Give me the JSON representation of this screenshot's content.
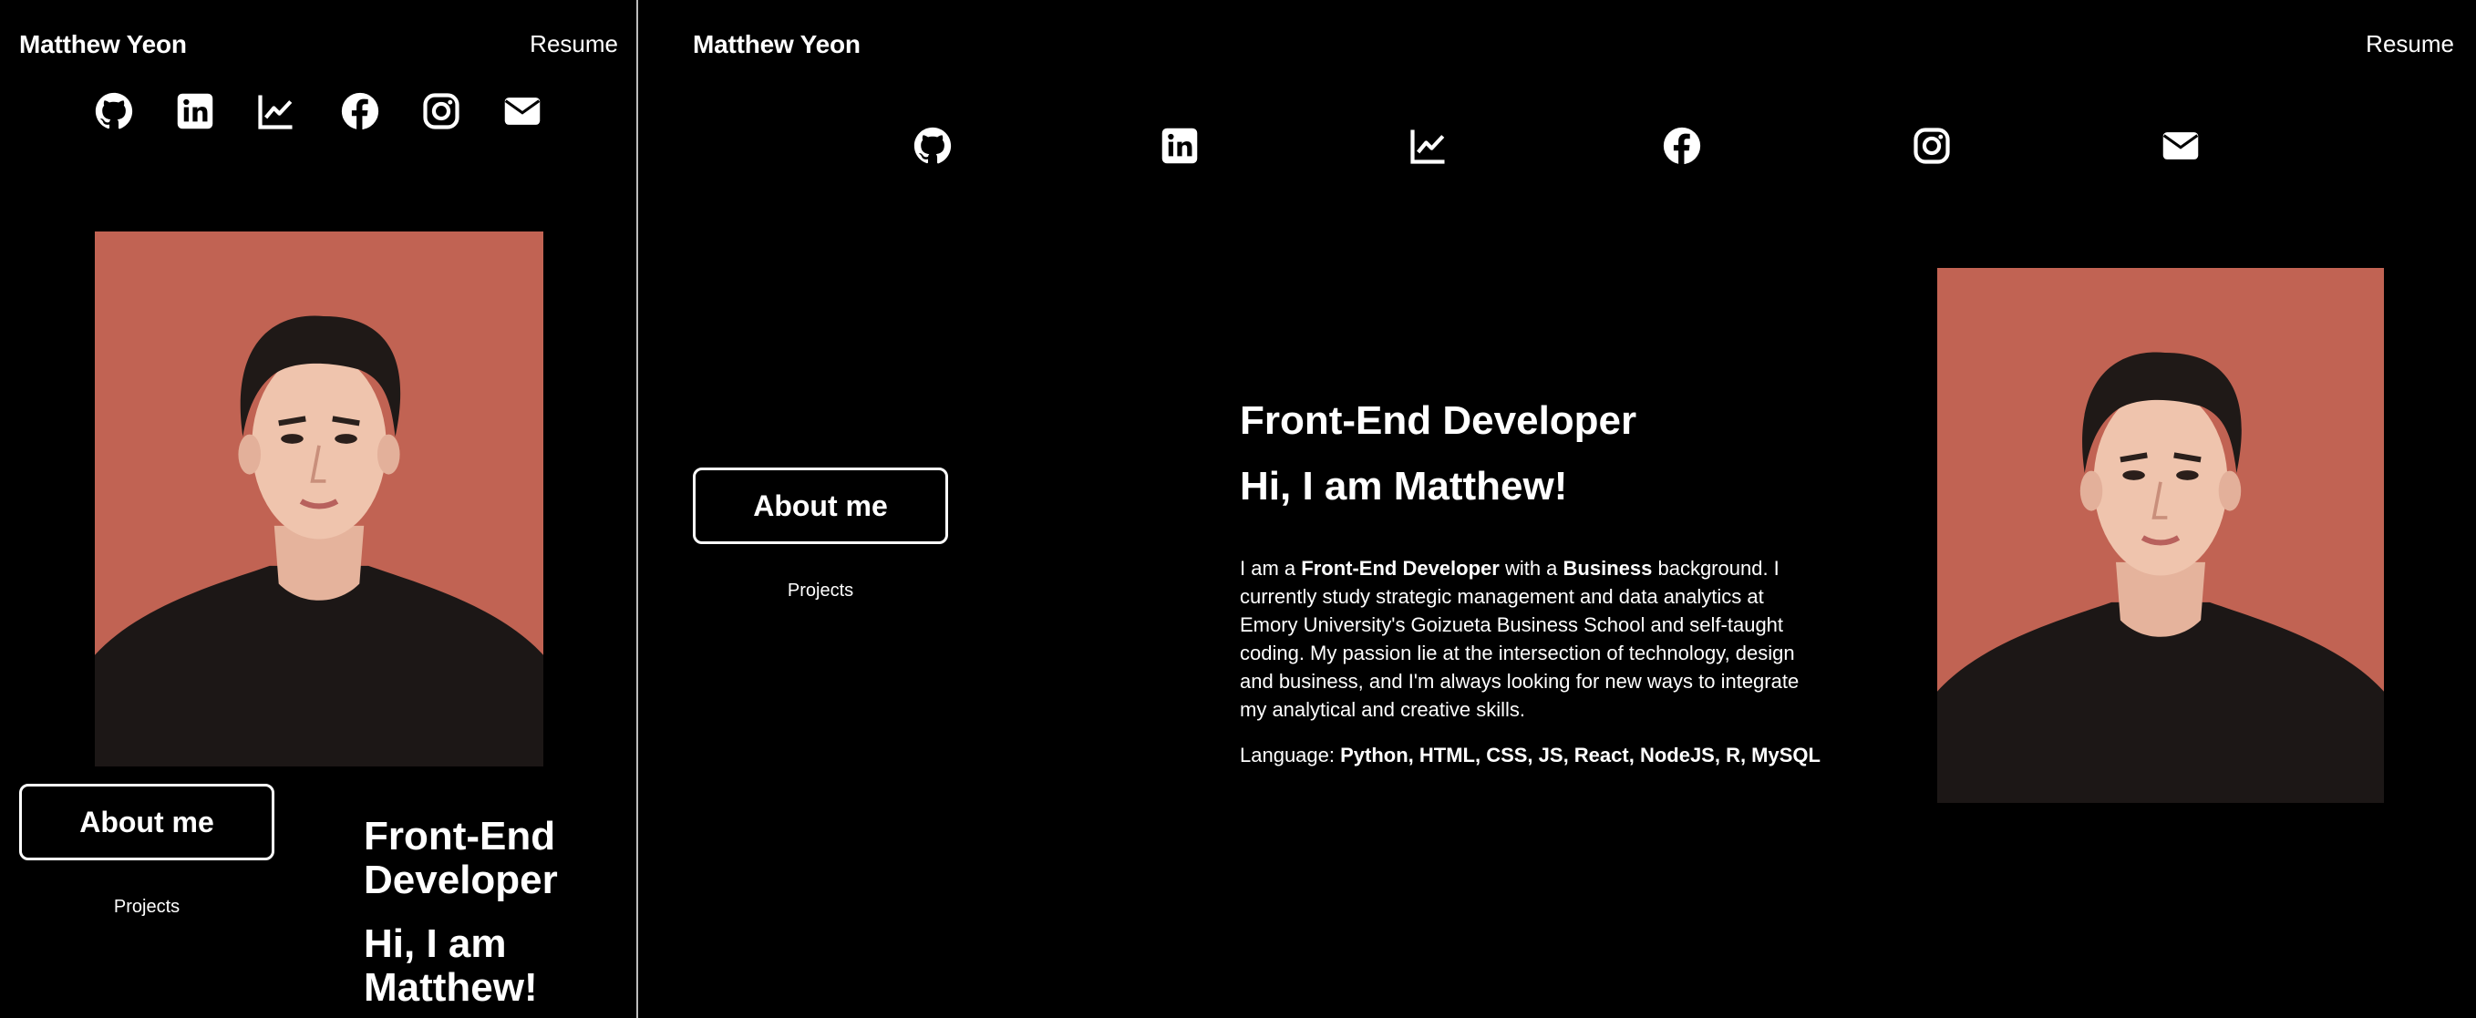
{
  "mobile": {
    "brand": "Matthew Yeon",
    "resume_label": "Resume",
    "about_label": "About me",
    "projects_label": "Projects",
    "role": "Front-End Developer",
    "greeting": "Hi, I am Matthew!"
  },
  "desktop": {
    "brand": "Matthew Yeon",
    "resume_label": "Resume",
    "about_label": "About me",
    "projects_label": "Projects",
    "role": "Front-End Developer",
    "greeting": "Hi, I am Matthew!",
    "bio": {
      "p1": "I am a ",
      "b1": "Front-End Developer",
      "p2": " with a ",
      "b2": "Business",
      "p3": " background. I currently study strategic management and data analytics at Emory University's Goizueta Business School and self-taught coding. My passion lie at the intersection of technology, design and business, and I'm always looking for new ways to integrate my analytical and creative skills."
    },
    "languages_label": "Language: ",
    "languages": "Python, HTML, CSS, JS, React, NodeJS, R, MySQL"
  },
  "social_icons": [
    "github-icon",
    "linkedin-icon",
    "chart-line-icon",
    "facebook-icon",
    "instagram-icon",
    "envelope-icon"
  ],
  "colors": {
    "background": "#000000",
    "text": "#ffffff",
    "divider": "#bdbdbd",
    "photo_backdrop": "#c86a5a"
  }
}
